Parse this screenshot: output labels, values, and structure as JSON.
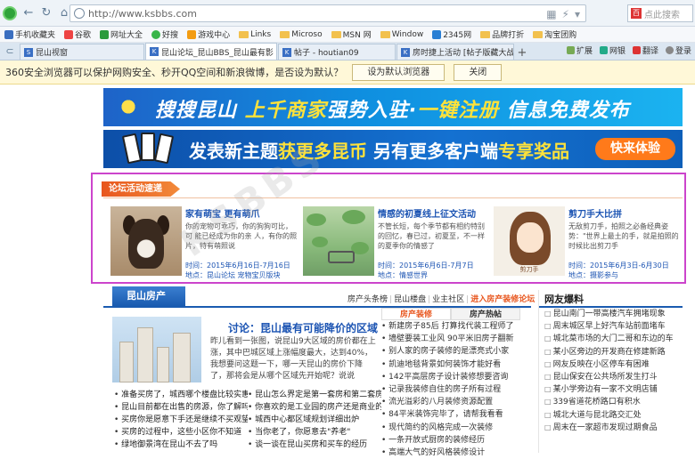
{
  "browser": {
    "url": "http://www.ksbbs.com",
    "search_placeholder": "点此搜索",
    "bookmarks": [
      "手机收藏夹",
      "谷歌",
      "网址大全",
      "好搜",
      "游戏中心",
      "Links",
      "Microso",
      "MSN 网",
      "Window",
      "2345网",
      "品牌打折",
      "淘宝团购"
    ],
    "tabs": [
      {
        "label": "昆山视窗"
      },
      {
        "label": "昆山论坛_昆山BBS_昆山最有影"
      },
      {
        "label": "帖子 - houtian09"
      },
      {
        "label": "房时捷上活动 [帖子版藏大战]"
      }
    ],
    "tab_tools": [
      "扩展",
      "网银",
      "翻译",
      "登录"
    ],
    "notify": {
      "text": "360安全浏览器可以保护网购安全、秒开QQ空间和新浪微博，是否设为默认？",
      "set_default": "设为默认浏览器",
      "close": "关闭"
    }
  },
  "banners": {
    "b1_a": "搜搜昆山",
    "b1_b": "上千商家",
    "b1_c": "强势入驻·",
    "b1_d": "一键注册",
    "b1_e": "信息免费发布",
    "b2_a": "发表新主题",
    "b2_b": "获更多昆币",
    "b2_c": "另有更多客户端",
    "b2_d": "专享奖品",
    "b2_btn": "快来体验"
  },
  "activity": {
    "title": "论坛活动速递",
    "items": [
      {
        "heading": "家有萌宝  更有萌爪",
        "desc": "你的宠物可乖巧，你的狗狗可比，可 能已经成为你的亲 人，有你的照片，特有萌照说",
        "time": "时间：2015年6月16日-7月16日",
        "place": "地点：昆山论坛 宠物宝贝版块"
      },
      {
        "heading": "情感的初夏线上征文活动",
        "desc": "不管长短，每个季节都有相约特别的回忆，春已过，初夏至，不一样的夏季你的情感了",
        "time": "时间：2015年6月6日-7月7日",
        "place": "地点：情感世界"
      },
      {
        "heading": "剪刀手大比拼",
        "desc": "无敌剪刀手，拍照之必备经典姿势：\"世界上最土的手，就是拍照的时候比出剪刀手",
        "time": "时间：2015年6月3日-6月30日",
        "place": "地点：摄影参与",
        "img_caption": "剪刀手"
      }
    ]
  },
  "section": {
    "tab": "昆山房产",
    "links": [
      "房产头条榜",
      "昆山楼盘",
      "业主社区"
    ],
    "highlight": "进入房产装修论坛",
    "news_title": "讨论：昆山最有可能降价的区域",
    "news_desc": "昨儿看到一张图，说昆山9大区域的房价都在上涨，其中巴城区域上涨幅度最大，达到40%，我想要问这题一下，哪一天昆山的房价下降了，那将会是从哪个区域先开始呢？说说",
    "list": [
      [
        "准备买房了，城西哪个楼盘比较实惠",
        "昆山怎么界定是第一套房和第二套房"
      ],
      [
        "昆山目前都在出售的房源，你了解吗",
        "你喜欢的是工业园的房产还是商业的"
      ],
      [
        "买房你是愿意下手还是继续不买观望呢",
        "城西中心都区域规划详细出炉"
      ],
      [
        "买房的过程中，这些小区你不知道",
        "当你老了，你愿意去\"养老\""
      ],
      [
        "绿地御景湾在昆山不去了吗",
        "谈一谈在昆山买房和买车的经历"
      ]
    ],
    "mid_tabs": [
      "房产装修",
      "房产热帖"
    ],
    "mid_list": [
      "新建房子85后 打算找代装工程师了",
      "墙壁要装工业风 90平米旧房子翻新",
      "别人家的房子装修的是漂亮式小家",
      "凯迪地毯背景如何装饰才能好看",
      "142平高层房子设计装修想要咨询",
      "记录我装修自住的房子所有过程",
      "流光溢彩的八月装修资源配置",
      "84平米装饰完毕了，请帮我看看",
      "现代简约的风格完成一次装修",
      "一条开放式厨房的装修经历",
      "高端大气的好风格装修设计"
    ],
    "right_head": "网友爆料",
    "right_list": [
      "昆山南门一带高楼汽车拥堵现象",
      "周末城区早上好汽车站前面堵车",
      "城北菜市场的大门二哥和东边的车",
      "某小区旁边的开发商在修建新路",
      "网友反映在小区停车有困难",
      "昆山保安在公共场所发生打斗",
      "某小学旁边有一家不文明店铺",
      "339省道花桥路口有积水",
      "城北大道与昆北路交汇处",
      "周末在一家超市发现过期食品"
    ]
  }
}
